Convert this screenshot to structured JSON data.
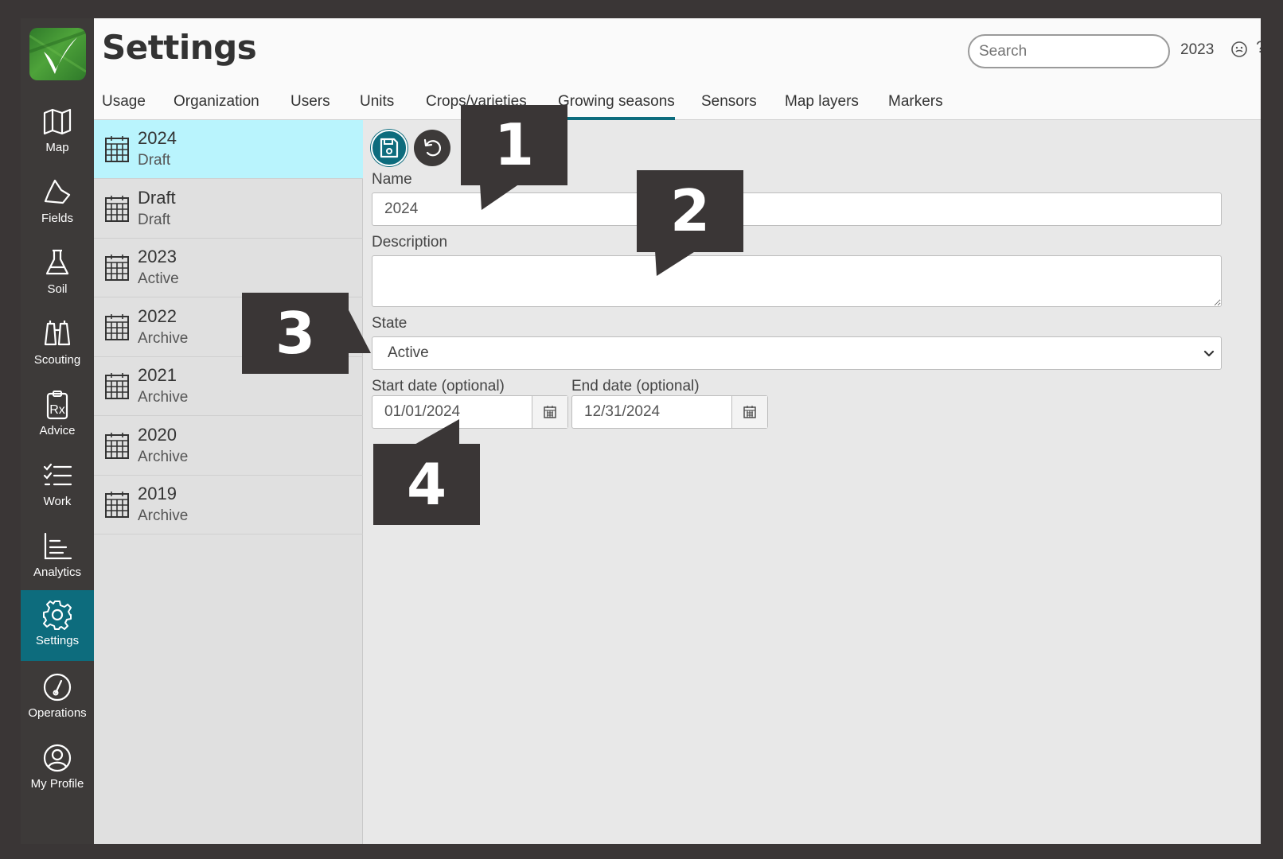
{
  "app": {
    "title": "Settings",
    "search_placeholder": "Search",
    "year": "2023",
    "help": "?"
  },
  "nav": {
    "items": [
      {
        "label": "Map",
        "icon": "map-icon"
      },
      {
        "label": "Fields",
        "icon": "fields-icon"
      },
      {
        "label": "Soil",
        "icon": "flask-icon"
      },
      {
        "label": "Scouting",
        "icon": "binoculars-icon"
      },
      {
        "label": "Advice",
        "icon": "prescription-clipboard-icon"
      },
      {
        "label": "Work",
        "icon": "checklist-icon"
      },
      {
        "label": "Analytics",
        "icon": "chart-icon"
      },
      {
        "label": "Settings",
        "icon": "gear-icon",
        "active": true
      },
      {
        "label": "Operations",
        "icon": "gauge-icon"
      },
      {
        "label": "My Profile",
        "icon": "user-circle-icon"
      }
    ]
  },
  "tabs": [
    "Usage",
    "Organization",
    "Users",
    "Units",
    "Crops/varieties",
    "Growing seasons",
    "Sensors",
    "Map layers",
    "Markers"
  ],
  "active_tab": "Growing seasons",
  "seasons": [
    {
      "name": "2024",
      "state": "Draft",
      "selected": true
    },
    {
      "name": "Draft",
      "state": "Draft"
    },
    {
      "name": "2023",
      "state": "Active"
    },
    {
      "name": "2022",
      "state": "Archive"
    },
    {
      "name": "2021",
      "state": "Archive"
    },
    {
      "name": "2020",
      "state": "Archive"
    },
    {
      "name": "2019",
      "state": "Archive"
    }
  ],
  "form": {
    "name_label": "Name",
    "name_value": "2024",
    "description_label": "Description",
    "description_value": "",
    "state_label": "State",
    "state_value": "Active",
    "start_label": "Start date (optional)",
    "start_value": "01/01/2024",
    "end_label": "End date (optional)",
    "end_value": "12/31/2024"
  },
  "callouts": [
    "1",
    "2",
    "3",
    "4"
  ],
  "colors": {
    "accent": "#0d6c7d",
    "nav_bg": "#3d3a39",
    "selected_row": "#b9f4fd",
    "callout_bg": "#3a3636"
  }
}
